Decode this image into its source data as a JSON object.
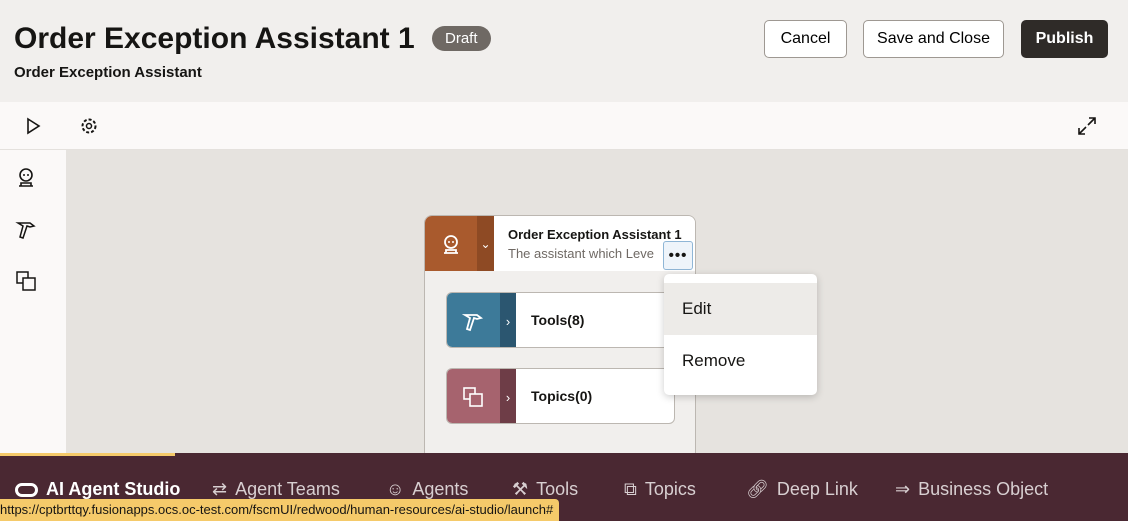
{
  "header": {
    "title": "Order Exception Assistant 1",
    "badge": "Draft",
    "subtitle": "Order Exception Assistant",
    "cancel": "Cancel",
    "save_close": "Save and Close",
    "publish": "Publish"
  },
  "toolbar": {
    "icons": [
      "play-icon",
      "gear-icon",
      "expand-icon"
    ]
  },
  "sidebar": {
    "icons": [
      "agent-icon",
      "tools-icon",
      "topics-icon"
    ]
  },
  "card": {
    "title": "Order Exception Assistant 1",
    "description": "The assistant which Leve",
    "tools": "Tools(8)",
    "topics": "Topics(0)"
  },
  "menu": {
    "items": [
      "Edit",
      "Remove"
    ]
  },
  "colors": {
    "agent": "#a95a2d",
    "tools": "#3d7a99",
    "topics": "#a6636e",
    "bar": "#4a2832",
    "accent": "#f5ca6a"
  },
  "nav": {
    "items": [
      "AI Agent Studio",
      "Agent Teams",
      "Agents",
      "Tools",
      "Topics",
      "Deep Link",
      "Business Object"
    ]
  },
  "status_url": "https://cptbrttqy.fusionapps.ocs.oc-test.com/fscmUI/redwood/human-resources/ai-studio/launch#"
}
